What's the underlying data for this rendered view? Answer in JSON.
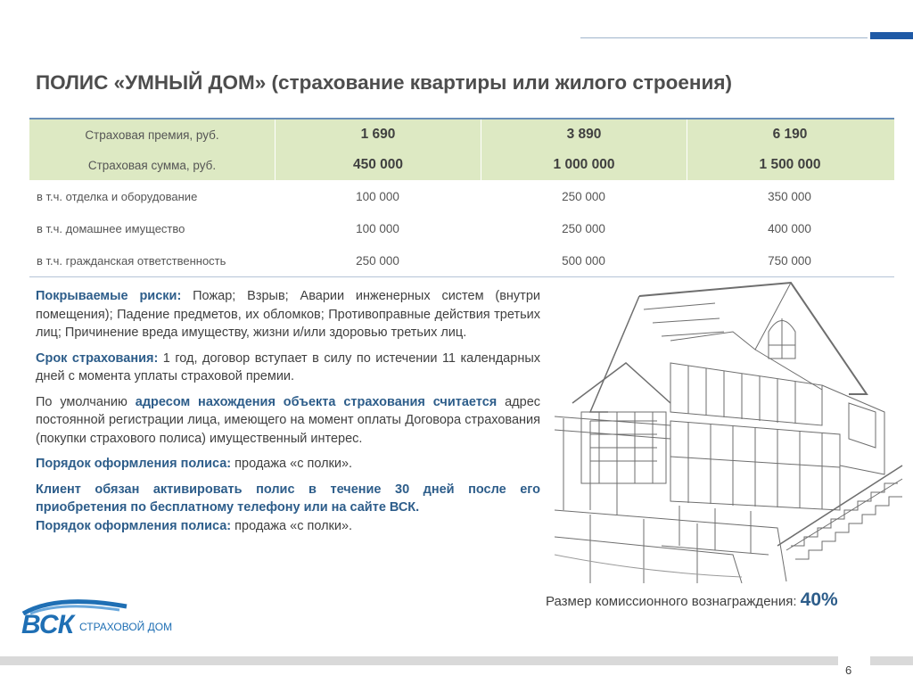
{
  "title": "ПОЛИС «УМНЫЙ ДОМ» (страхование квартиры или жилого строения)",
  "table": {
    "rows": [
      {
        "label": "Страховая премия, руб.",
        "values": [
          "1 690",
          "3 890",
          "6 190"
        ]
      },
      {
        "label": "Страховая сумма, руб.",
        "values": [
          "450 000",
          "1 000 000",
          "1 500 000"
        ]
      },
      {
        "label": "в т.ч. отделка и оборудование",
        "values": [
          "100 000",
          "250 000",
          "350 000"
        ]
      },
      {
        "label": "в т.ч. домашнее имущество",
        "values": [
          "100 000",
          "250 000",
          "400 000"
        ]
      },
      {
        "label": "в т.ч. гражданская ответственность",
        "values": [
          "250 000",
          "500 000",
          "750 000"
        ]
      }
    ]
  },
  "text": {
    "risks_label": "Покрываемые риски:",
    "risks_text": " Пожар; Взрыв; Аварии инженерных систем (внутри помещения); Падение предметов, их обломков; Противоправные действия третьих лиц; Причинение вреда имуществу, жизни и/или здоровью третьих лиц.",
    "term_label": "Срок страхования:",
    "term_text": " 1 год, договор вступает в силу по истечении 11 календарных дней с момента уплаты страховой премии.",
    "address_pre": "По умолчанию ",
    "address_label": "адресом нахождения объекта страхования считается",
    "address_text": " адрес постоянной регистрации лица, имеющего на момент оплаты Договора страхования (покупки страхового полиса) имущественный интерес.",
    "order1_label": "Порядок оформления полиса:",
    "order1_text": " продажа «с полки».",
    "activate": "Клиент обязан активировать полис в течение 30 дней после его приобретения по бесплатному телефону или на сайте ВСК.",
    "order2_label": "Порядок оформления полиса:",
    "order2_text": " продажа «с полки»."
  },
  "commission": {
    "label": "Размер комиссионного вознаграждения: ",
    "value": "40%"
  },
  "logo": {
    "main": "ВСК",
    "sub": "СТРАХОВОЙ ДОМ"
  },
  "page_number": "6",
  "colors": {
    "accent": "#2d5d8a",
    "table_green": "#dde9c3",
    "logo_blue": "#1f6fb4"
  }
}
